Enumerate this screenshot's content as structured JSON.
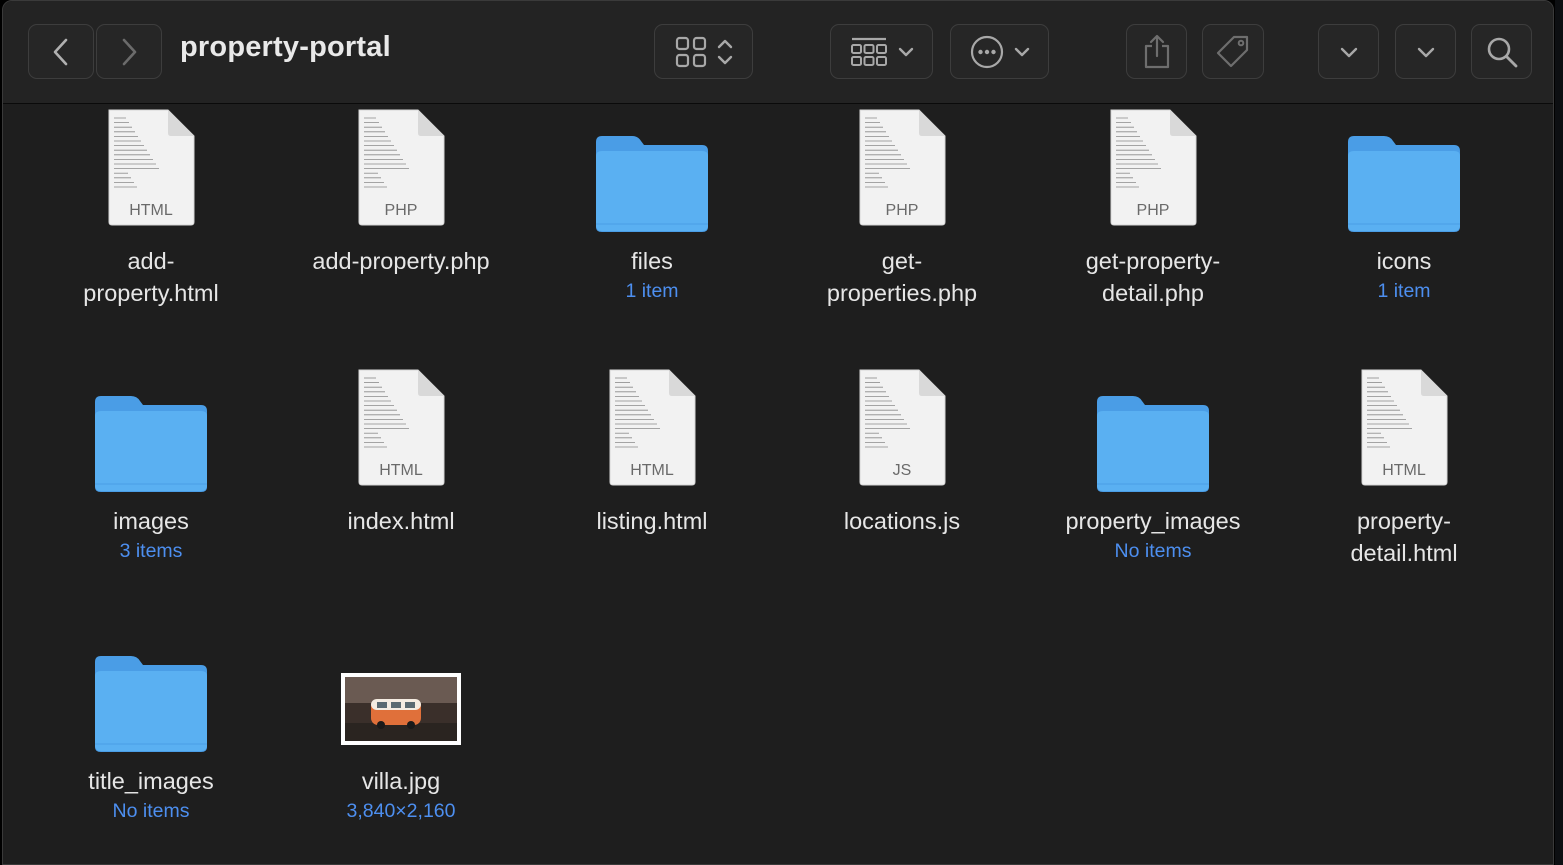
{
  "window": {
    "title": "property-portal"
  },
  "toolbar": {
    "back": "chevron-left-icon",
    "forward": "chevron-right-icon",
    "view": "icon-grid-view-icon",
    "group": "group-by-icon",
    "more": "more-actions-icon",
    "share": "share-icon",
    "tag": "tag-icon",
    "dropdown1": "chevron-down-icon",
    "dropdown2": "chevron-down-icon",
    "search": "search-icon"
  },
  "colors": {
    "folder": "#5ab0f2",
    "folder_tab": "#4a9de6",
    "subtitle": "#4d8ff0",
    "background": "#1e1e1e"
  },
  "items": [
    {
      "kind": "doc",
      "ext": "HTML",
      "line1": "add-",
      "line2": "property.html"
    },
    {
      "kind": "doc",
      "ext": "PHP",
      "line1": "add-property.php"
    },
    {
      "kind": "folder",
      "line1": "files",
      "sub": "1 item"
    },
    {
      "kind": "doc",
      "ext": "PHP",
      "line1": "get-",
      "line2": "properties.php"
    },
    {
      "kind": "doc",
      "ext": "PHP",
      "line1": "get-property-",
      "line2": "detail.php"
    },
    {
      "kind": "folder",
      "line1": "icons",
      "sub": "1 item"
    },
    {
      "kind": "folder",
      "line1": "images",
      "sub": "3 items"
    },
    {
      "kind": "doc",
      "ext": "HTML",
      "line1": "index.html"
    },
    {
      "kind": "doc",
      "ext": "HTML",
      "line1": "listing.html"
    },
    {
      "kind": "doc",
      "ext": "JS",
      "line1": "locations.js"
    },
    {
      "kind": "folder",
      "line1": "property_images",
      "sub": "No items"
    },
    {
      "kind": "doc",
      "ext": "HTML",
      "line1": "property-",
      "line2": "detail.html"
    },
    {
      "kind": "folder",
      "line1": "title_images",
      "sub": "No items"
    },
    {
      "kind": "image",
      "line1": "villa.jpg",
      "sub": "3,840×2,160"
    }
  ]
}
